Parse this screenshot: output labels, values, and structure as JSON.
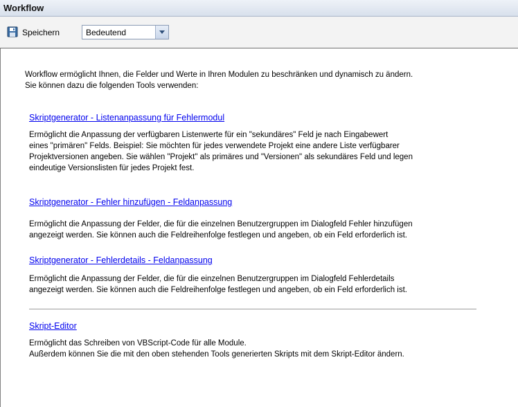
{
  "window": {
    "title": "Workflow"
  },
  "toolbar": {
    "save_label": "Speichern",
    "combo_value": "Bedeutend"
  },
  "intro": {
    "line1": "Workflow ermöglicht Ihnen, die Felder und Werte in Ihren Modulen zu beschränken und dynamisch zu ändern.",
    "line2": "Sie können dazu die folgenden Tools verwenden:"
  },
  "sections": [
    {
      "link": "Skriptgenerator - Listenanpassung für Fehlermodul",
      "lines": [
        "Ermöglicht die Anpassung der verfügbaren Listenwerte für ein \"sekundäres\" Feld je nach Eingabewert",
        "eines \"primären\" Felds. Beispiel: Sie möchten für jedes verwendete Projekt eine andere Liste verfügbarer",
        "Projektversionen angeben. Sie wählen \"Projekt\" als primäres und \"Versionen\" als sekundäres Feld und legen",
        "eindeutige Versionslisten für jedes Projekt fest."
      ]
    },
    {
      "link": "Skriptgenerator - Fehler hinzufügen - Feldanpassung",
      "lines": [
        "Ermöglicht die Anpassung der Felder, die für die einzelnen Benutzergruppen im Dialogfeld Fehler hinzufügen",
        "angezeigt werden. Sie können auch die Feldreihenfolge festlegen und angeben, ob ein Feld erforderlich ist."
      ]
    },
    {
      "link": "Skriptgenerator - Fehlerdetails - Feldanpassung",
      "lines": [
        "Ermöglicht die Anpassung der Felder, die für die einzelnen Benutzergruppen im Dialogfeld Fehlerdetails",
        "angezeigt werden. Sie können auch die Feldreihenfolge festlegen und angeben, ob ein Feld erforderlich ist."
      ]
    },
    {
      "link": "Skript-Editor",
      "lines": [
        "Ermöglicht das Schreiben von VBScript-Code für alle Module.",
        "Außerdem können Sie die mit den oben stehenden Tools generierten Skripts mit dem Skript-Editor ändern."
      ]
    }
  ]
}
